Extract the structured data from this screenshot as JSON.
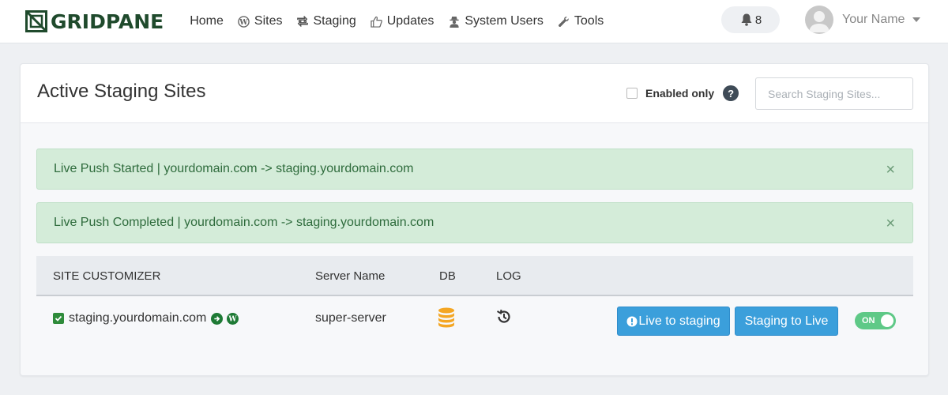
{
  "brand": {
    "name": "GRIDPANE"
  },
  "nav": {
    "items": [
      {
        "label": "Home",
        "icon": ""
      },
      {
        "label": "Sites",
        "icon": "wordpress-icon"
      },
      {
        "label": "Staging",
        "icon": "retweet-icon"
      },
      {
        "label": "Updates",
        "icon": "thumbs-up-icon"
      },
      {
        "label": "System Users",
        "icon": "user-secret-icon"
      },
      {
        "label": "Tools",
        "icon": "wrench-icon"
      }
    ]
  },
  "notifications": {
    "count": "8",
    "icon": "bell-icon"
  },
  "user": {
    "name": "Your Name"
  },
  "panel": {
    "title": "Active Staging Sites",
    "enabled_only_label": "Enabled only",
    "help_label": "?",
    "search_placeholder": "Search Staging Sites..."
  },
  "alerts": [
    {
      "text": "Live Push Started | yourdomain.com -> staging.yourdomain.com",
      "close": "×"
    },
    {
      "text": "Live Push Completed | yourdomain.com -> staging.yourdomain.com",
      "close": "×"
    }
  ],
  "table": {
    "headers": {
      "site": "SITE CUSTOMIZER",
      "server": "Server Name",
      "db": "DB",
      "log": "LOG"
    },
    "rows": [
      {
        "site": "staging.yourdomain.com",
        "server": "super-server",
        "actions": {
          "live_to_staging": "Live to staging",
          "staging_to_live": "Staging to Live"
        },
        "toggle": "ON"
      }
    ]
  },
  "colors": {
    "brand": "#1f4a2c",
    "primary": "#3b9fdb",
    "success_bg": "#d4ecd9",
    "toggle_on": "#5fc987",
    "db_icon": "#f4a623"
  }
}
